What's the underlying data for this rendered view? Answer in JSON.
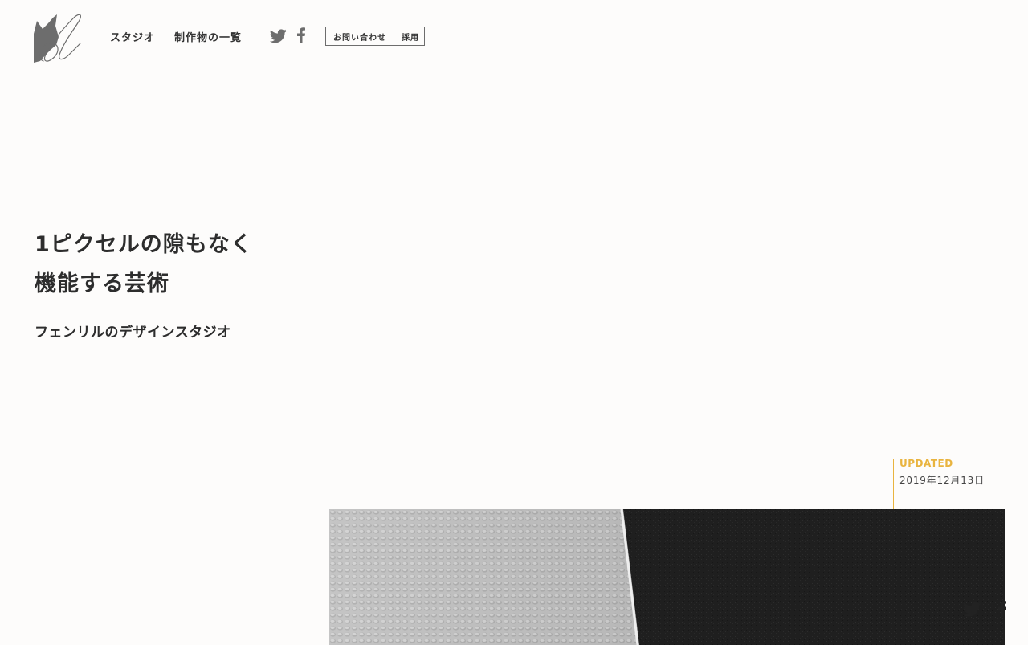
{
  "header": {
    "logo_icon": "fenrir-logo-icon",
    "nav": {
      "studio": "スタジオ",
      "works": "制作物の一覧"
    },
    "social": {
      "twitter_icon": "twitter-icon",
      "facebook_icon": "facebook-icon"
    },
    "contact": {
      "inquiry": "お問い合わせ",
      "recruit": "採用"
    }
  },
  "hero": {
    "headline_line1": "1ピクセルの隙もなく",
    "headline_line2": "機能する芸術",
    "subhead": "フェンリルのデザインスタジオ"
  },
  "updated": {
    "label": "UPDATED",
    "date": "2019年12月13日"
  },
  "share": {
    "twitter_icon": "twitter-icon",
    "facebook_icon": "facebook-icon"
  },
  "colors": {
    "background": "#fdfcfb",
    "text": "#2d2d2d",
    "accent": "#e9b43f",
    "icon": "#6d6d6d"
  }
}
